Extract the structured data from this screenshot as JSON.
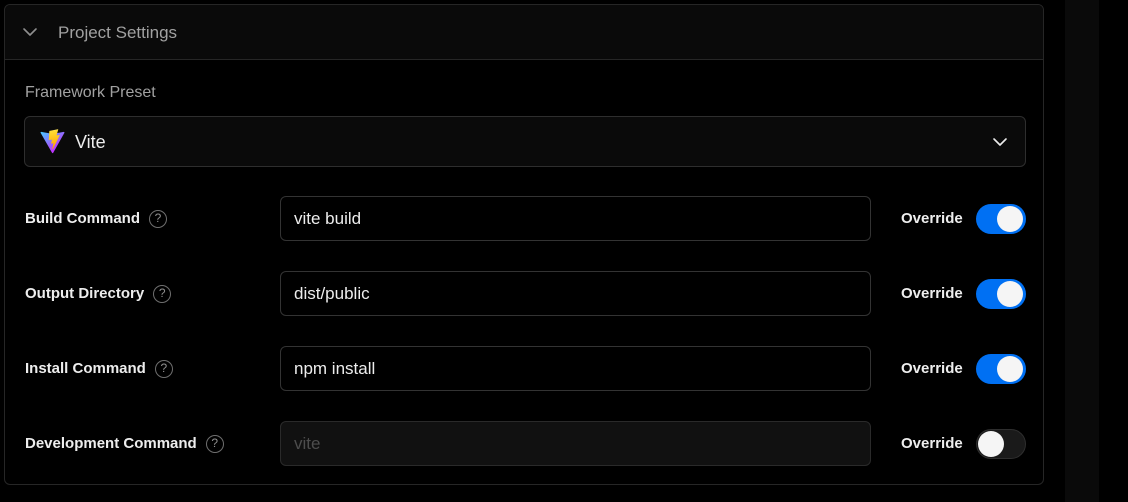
{
  "panel": {
    "title": "Project Settings",
    "icon": "chevron-down-icon"
  },
  "framework_preset": {
    "label": "Framework Preset",
    "value": "Vite",
    "icon": "vite-logo-icon"
  },
  "rows": [
    {
      "label": "Build Command",
      "value": "vite build",
      "placeholder": "",
      "override_label": "Override",
      "override": true,
      "disabled": false
    },
    {
      "label": "Output Directory",
      "value": "dist/public",
      "placeholder": "",
      "override_label": "Override",
      "override": true,
      "disabled": false
    },
    {
      "label": "Install Command",
      "value": "npm install",
      "placeholder": "",
      "override_label": "Override",
      "override": true,
      "disabled": false
    },
    {
      "label": "Development Command",
      "value": "",
      "placeholder": "vite",
      "override_label": "Override",
      "override": false,
      "disabled": true
    }
  ],
  "colors": {
    "accent": "#0070f3",
    "background": "#000000",
    "border": "#262626"
  }
}
